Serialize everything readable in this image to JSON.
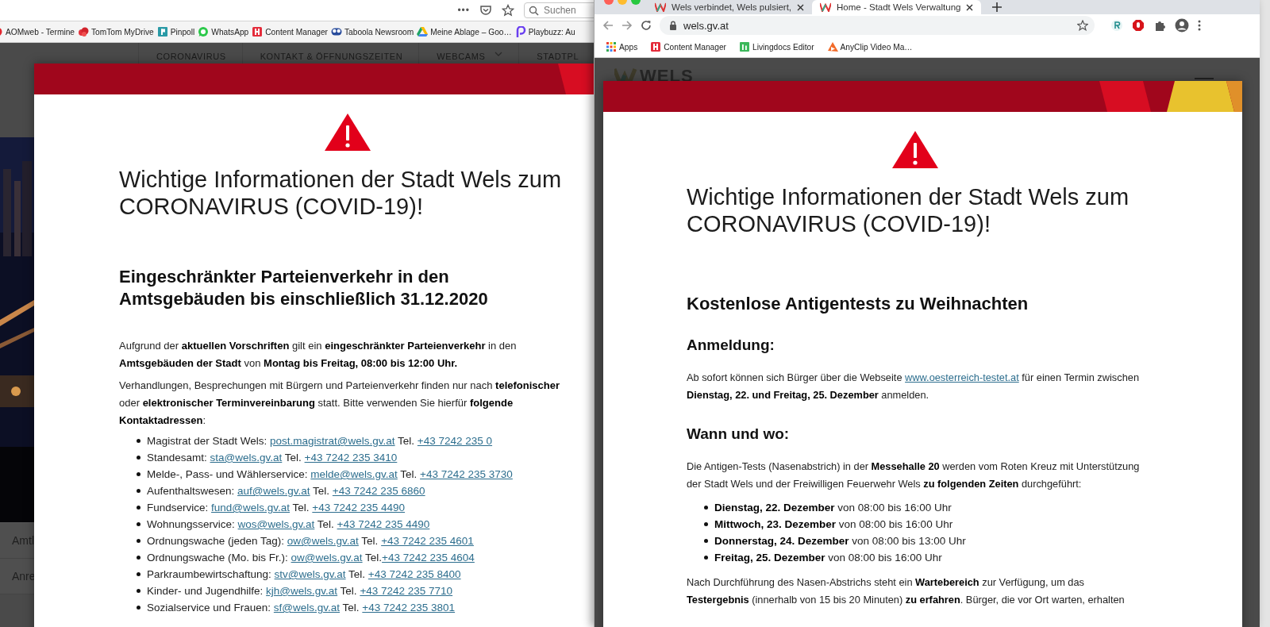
{
  "left_window": {
    "toolbar": {
      "more": "•••",
      "search": {
        "placeholder": "Suchen"
      }
    },
    "bookmarks": [
      {
        "label": "AOMweb - Termine",
        "kind": "dot"
      },
      {
        "label": "TomTom MyDrive",
        "kind": "blob"
      },
      {
        "label": "Pinpoll",
        "kind": "tile"
      },
      {
        "label": "WhatsApp",
        "kind": "chat"
      },
      {
        "label": "Content Manager",
        "kind": "hbox"
      },
      {
        "label": "Taboola Newsroom",
        "kind": "eyes"
      },
      {
        "label": "Meine Ablage – Goo…",
        "kind": "drive"
      },
      {
        "label": "Playbuzz: Au",
        "kind": "ploop"
      }
    ],
    "site_nav": [
      {
        "label": "CORONAVIRUS",
        "dropdown": false
      },
      {
        "label": "KONTAKT & ÖFFNUNGSZEITEN",
        "dropdown": false
      },
      {
        "label": "WEBCAMS",
        "dropdown": true
      },
      {
        "label": "STADTPL",
        "dropdown": false
      }
    ],
    "side_items": [
      "Amtl",
      "Anre"
    ],
    "modal": {
      "title": "Wichtige Informationen der Stadt Wels zum CORONAVIRUS (COVID-19)!",
      "heading": "Eingeschränkter Parteienverkehr in den Amtsgebäuden bis einschließlich 31.12.2020",
      "blocks": [
        {
          "kind": "paragraph",
          "parts": [
            {
              "kind": "text",
              "text": "Aufgrund der **aktuellen Vorschriften** gilt ein **eingeschränkter Parteienverkehr** in den **Amtsgebäuden der Stadt** von **Montag bis Freitag, 08:00 bis 12:00 Uhr.**"
            }
          ]
        },
        {
          "kind": "paragraph",
          "parts": [
            {
              "kind": "text",
              "text": "Verhandlungen, Besprechungen mit Bürgern und Parteienverkehr finden nur nach **telefonischer** oder **elektronischer Terminvereinbarung** statt. Bitte verwenden Sie hierfür **folgende Kontaktadressen**:"
            }
          ]
        },
        {
          "kind": "list",
          "items": [
            [
              {
                "kind": "text",
                "text": "Magistrat der Stadt Wels: "
              },
              {
                "kind": "link",
                "text": "post.magistrat@wels.gv.at"
              },
              {
                "kind": "text",
                "text": " Tel. "
              },
              {
                "kind": "link",
                "text": "+43 7242 235 0"
              }
            ],
            [
              {
                "kind": "text",
                "text": "Standesamt: "
              },
              {
                "kind": "link",
                "text": "sta@wels.gv.at"
              },
              {
                "kind": "text",
                "text": " Tel. "
              },
              {
                "kind": "link",
                "text": "+43 7242 235 3410"
              }
            ],
            [
              {
                "kind": "text",
                "text": "Melde-, Pass- und Wählerservice: "
              },
              {
                "kind": "link",
                "text": "melde@wels.gv.at"
              },
              {
                "kind": "text",
                "text": " Tel. "
              },
              {
                "kind": "link",
                "text": "+43 7242 235 3730"
              }
            ],
            [
              {
                "kind": "text",
                "text": "Aufenthaltswesen: "
              },
              {
                "kind": "link",
                "text": "auf@wels.gv.at"
              },
              {
                "kind": "text",
                "text": " Tel. "
              },
              {
                "kind": "link",
                "text": "+43 7242 235 6860"
              }
            ],
            [
              {
                "kind": "text",
                "text": "Fundservice: "
              },
              {
                "kind": "link",
                "text": "fund@wels.gv.at"
              },
              {
                "kind": "text",
                "text": " Tel. "
              },
              {
                "kind": "link",
                "text": "+43 7242 235 4490"
              }
            ],
            [
              {
                "kind": "text",
                "text": "Wohnungsservice: "
              },
              {
                "kind": "link",
                "text": "wos@wels.gv.at"
              },
              {
                "kind": "text",
                "text": " Tel. "
              },
              {
                "kind": "link",
                "text": "+43 7242 235 4490"
              }
            ],
            [
              {
                "kind": "text",
                "text": "Ordnungswache (jeden Tag): "
              },
              {
                "kind": "link",
                "text": "ow@wels.gv.at"
              },
              {
                "kind": "text",
                "text": " Tel. "
              },
              {
                "kind": "link",
                "text": "+43 7242 235 4601"
              }
            ],
            [
              {
                "kind": "text",
                "text": "Ordnungswache (Mo. bis Fr.): "
              },
              {
                "kind": "link",
                "text": "ow@wels.gv.at"
              },
              {
                "kind": "text",
                "text": " Tel."
              },
              {
                "kind": "link",
                "text": "+43 7242 235 4604"
              }
            ],
            [
              {
                "kind": "text",
                "text": "Parkraumbewirtschaftung: "
              },
              {
                "kind": "link",
                "text": "stv@wels.gv.at"
              },
              {
                "kind": "text",
                "text": " Tel. "
              },
              {
                "kind": "link",
                "text": "+43 7242 235 8400"
              }
            ],
            [
              {
                "kind": "text",
                "text": "Kinder- und Jugendhilfe: "
              },
              {
                "kind": "link",
                "text": "kjh@wels.gv.at"
              },
              {
                "kind": "text",
                "text": " Tel. "
              },
              {
                "kind": "link",
                "text": "+43 7242 235 7710"
              }
            ],
            [
              {
                "kind": "text",
                "text": "Sozialservice und Frauen: "
              },
              {
                "kind": "link",
                "text": "sf@wels.gv.at"
              },
              {
                "kind": "text",
                "text": " Tel. "
              },
              {
                "kind": "link",
                "text": "+43 7242 235 3801"
              }
            ]
          ]
        }
      ]
    }
  },
  "right_window": {
    "tabs": [
      {
        "label": "Wels verbindet, Wels pulsiert,",
        "selected": false
      },
      {
        "label": "Home - Stadt Wels Verwaltung",
        "selected": true
      }
    ],
    "address": "wels.gv.at",
    "bookmarks": [
      {
        "label": "Apps",
        "kind": "grid"
      },
      {
        "label": "Content Manager",
        "kind": "hbox"
      },
      {
        "label": "Livingdocs Editor",
        "kind": "greenbox"
      },
      {
        "label": "AnyClip Video Ma…",
        "kind": "cone"
      }
    ],
    "site_logo": "WELS",
    "modal": {
      "title": "Wichtige Informationen der Stadt Wels zum CORONAVIRUS (COVID-19)!",
      "heading": "Kostenlose Antigentests zu Weihnachten",
      "blocks": [
        {
          "kind": "subheading",
          "text": "Anmeldung:"
        },
        {
          "kind": "paragraph",
          "parts": [
            {
              "kind": "text",
              "text": "Ab sofort können sich Bürger über die Webseite "
            },
            {
              "kind": "link",
              "text": "www.oesterreich-testet.at"
            },
            {
              "kind": "text",
              "text": " für einen Termin zwischen **Dienstag, 22. und Freitag, 25. Dezember** anmelden."
            }
          ]
        },
        {
          "kind": "subheading",
          "text": "Wann und wo:"
        },
        {
          "kind": "paragraph",
          "parts": [
            {
              "kind": "text",
              "text": "Die Antigen-Tests (Nasenabstrich) in der **Messehalle 20** werden vom Roten Kreuz mit Unterstützung der Stadt Wels und der Freiwilligen Feuerwehr Wels **zu folgenden Zeiten** durchgeführt:"
            }
          ]
        },
        {
          "kind": "list",
          "items": [
            [
              {
                "kind": "text",
                "text": "**Dienstag, 22. Dezember** von 08:00 bis 16:00 Uhr"
              }
            ],
            [
              {
                "kind": "text",
                "text": "**Mittwoch, 23. Dezember** von 08:00 bis 16:00 Uhr"
              }
            ],
            [
              {
                "kind": "text",
                "text": "**Donnerstag, 24. Dezember** von 08:00 bis 13:00 Uhr"
              }
            ],
            [
              {
                "kind": "text",
                "text": "**Freitag, 25. Dezember** von 08:00 bis 16:00 Uhr"
              }
            ]
          ]
        },
        {
          "kind": "paragraph",
          "parts": [
            {
              "kind": "text",
              "text": "Nach Durchführung des Nasen-Abstrichs steht ein **Wartebereich** zur Verfügung, um das **Testergebnis** (innerhalb von 15 bis 20 Minuten) **zu erfahren**. Bürger, die vor Ort warten, erhalten"
            }
          ]
        }
      ]
    }
  }
}
